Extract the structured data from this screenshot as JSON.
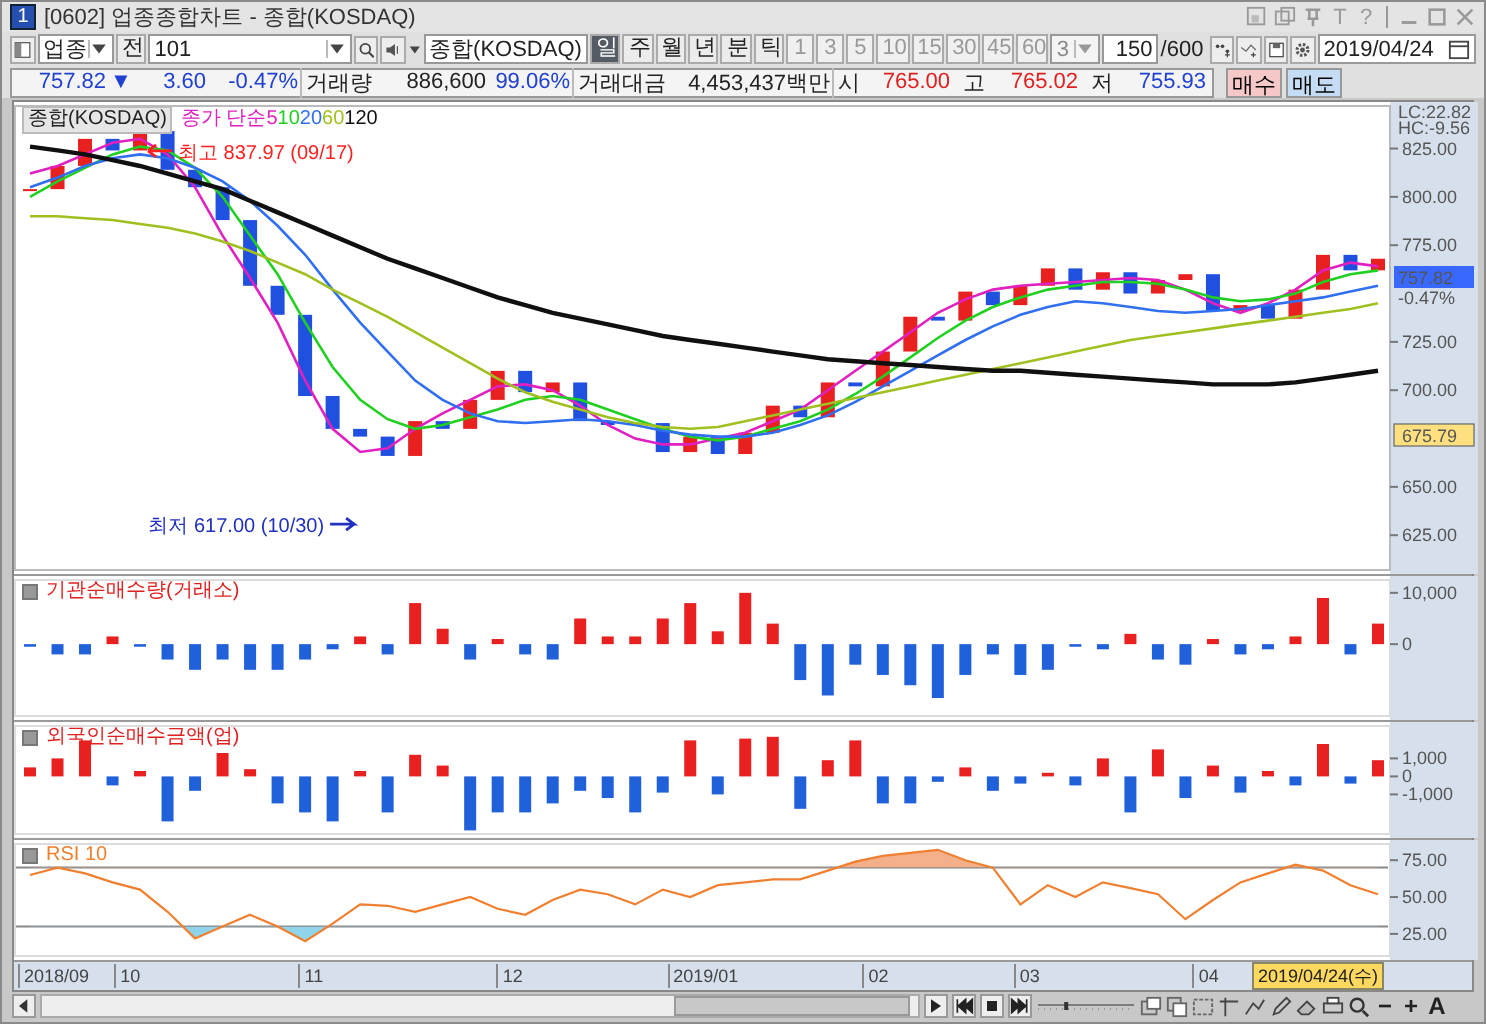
{
  "window": {
    "badge": "1",
    "title": "[0602] 업종종합차트 - 종합(KOSDAQ)",
    "help_glyphs": [
      "T",
      "?"
    ]
  },
  "toolbar": {
    "market": "업종",
    "all_button": "전",
    "code": "101",
    "name": "종합(KOSDAQ)",
    "periods": [
      {
        "label": "일",
        "selected": true
      },
      {
        "label": "주",
        "selected": false
      },
      {
        "label": "월",
        "selected": false
      },
      {
        "label": "년",
        "selected": false
      },
      {
        "label": "분",
        "selected": false
      },
      {
        "label": "틱",
        "selected": false
      }
    ],
    "intervals": [
      {
        "label": "1",
        "disabled": true
      },
      {
        "label": "3",
        "disabled": true
      },
      {
        "label": "5",
        "disabled": true
      },
      {
        "label": "10",
        "disabled": true
      },
      {
        "label": "15",
        "disabled": true
      },
      {
        "label": "30",
        "disabled": true
      },
      {
        "label": "45",
        "disabled": true
      },
      {
        "label": "60",
        "disabled": true
      }
    ],
    "interval_value": "3",
    "count": "150",
    "count_max": "/600",
    "date": "2019/04/24"
  },
  "quote": {
    "price": "757.82",
    "direction": "▼",
    "change": "3.60",
    "change_pct": "-0.47%",
    "volume_label": "거래량",
    "volume": "886,600",
    "volume_ratio": "99.06%",
    "amount_label": "거래대금",
    "amount": "4,453,437백만",
    "open_label": "시",
    "open": "765.00",
    "high_label": "고",
    "high": "765.02",
    "low_label": "저",
    "low": "755.93",
    "buy_button": "매수",
    "sell_button": "매도"
  },
  "price_chart": {
    "title": "종합(KOSDAQ)",
    "legend_prefix": "종가 단순",
    "lc": "LC:22.82",
    "hc": "HC:-9.56",
    "price_tag": "757.82",
    "price_tag_change": "-0.47%",
    "level_tag": "675.79",
    "chart_data": {
      "type": "line",
      "ylim": [
        607,
        847
      ],
      "yticks": [
        {
          "value": 825,
          "label": "825.00"
        },
        {
          "value": 800,
          "label": "800.00"
        },
        {
          "value": 775,
          "label": "775.00"
        },
        {
          "value": 725,
          "label": "725.00"
        },
        {
          "value": 700,
          "label": "700.00"
        },
        {
          "value": 650,
          "label": "650.00"
        },
        {
          "value": 625,
          "label": "625.00"
        }
      ],
      "series": [
        {
          "name": "5",
          "color": "#e020c0",
          "values": [
            812,
            816,
            822,
            828,
            830,
            822,
            805,
            780,
            758,
            735,
            705,
            680,
            668,
            670,
            680,
            688,
            695,
            702,
            703,
            700,
            692,
            682,
            675,
            672,
            672,
            675,
            678,
            684,
            690,
            700,
            710,
            720,
            730,
            740,
            747,
            752,
            754,
            755,
            756,
            757,
            758,
            757,
            752,
            745,
            740,
            745,
            752,
            762,
            766,
            764
          ]
        },
        {
          "name": "10",
          "color": "#20d020",
          "values": [
            800,
            808,
            815,
            822,
            826,
            824,
            815,
            800,
            780,
            760,
            735,
            712,
            695,
            685,
            680,
            682,
            686,
            690,
            695,
            697,
            695,
            690,
            685,
            680,
            676,
            674,
            676,
            680,
            684,
            690,
            698,
            707,
            717,
            727,
            736,
            743,
            748,
            752,
            754,
            756,
            756,
            755,
            752,
            748,
            746,
            747,
            750,
            756,
            760,
            762
          ]
        },
        {
          "name": "20",
          "color": "#3070f0",
          "values": [
            805,
            810,
            816,
            820,
            822,
            820,
            815,
            808,
            798,
            785,
            770,
            752,
            735,
            720,
            705,
            695,
            688,
            684,
            683,
            684,
            685,
            684,
            682,
            679,
            677,
            676,
            676,
            678,
            682,
            687,
            694,
            702,
            710,
            718,
            726,
            733,
            739,
            743,
            746,
            745,
            743,
            741,
            740,
            741,
            742,
            744,
            746,
            748,
            751,
            754
          ]
        },
        {
          "name": "60",
          "color": "#a0c020",
          "values": [
            790,
            790,
            789,
            788,
            786,
            784,
            781,
            777,
            772,
            766,
            760,
            752,
            745,
            738,
            730,
            722,
            714,
            706,
            699,
            694,
            690,
            686,
            683,
            681,
            680,
            681,
            684,
            687,
            690,
            693,
            696,
            699,
            702,
            705,
            708,
            711,
            714,
            717,
            720,
            723,
            726,
            728,
            730,
            732,
            734,
            736,
            738,
            740,
            742,
            745
          ]
        },
        {
          "name": "120",
          "color": "#101010",
          "values": [
            826,
            824,
            822,
            819,
            816,
            812,
            808,
            804,
            798,
            792,
            786,
            780,
            774,
            768,
            763,
            758,
            753,
            748,
            744,
            740,
            737,
            734,
            731,
            728,
            726,
            724,
            722,
            720,
            718,
            716,
            715,
            714,
            713,
            712,
            711,
            710,
            710,
            709,
            708,
            707,
            706,
            705,
            704,
            703,
            703,
            703,
            704,
            706,
            708,
            710
          ]
        }
      ],
      "annotations": [
        "최고 837.97 (09/17)",
        "최저 617.00 (10/30)"
      ]
    }
  },
  "institution_panel": {
    "title": "기관순매수량(거래소)",
    "chart_data": {
      "type": "bar",
      "ylim": [
        -14000,
        12500
      ],
      "yticks": [
        {
          "value": 10000,
          "label": "10,000"
        },
        0
      ],
      "values": [
        -500,
        -2000,
        -2000,
        1500,
        -500,
        -3000,
        -5000,
        -3000,
        -5000,
        -5000,
        -3000,
        -1000,
        1500,
        -2000,
        8000,
        3000,
        -3000,
        1000,
        -2000,
        -3000,
        5000,
        1500,
        1500,
        5000,
        8000,
        2500,
        10000,
        4000,
        -7000,
        -10000,
        -4000,
        -6000,
        -8000,
        -10500,
        -6000,
        -2000,
        -6000,
        -5000,
        -500,
        -1000,
        2000,
        -3000,
        -4000,
        1000,
        -2000,
        -1000,
        1500,
        9000,
        -2000,
        4000
      ]
    }
  },
  "foreign_panel": {
    "title": "외국인순매수금액(업)",
    "chart_data": {
      "type": "bar",
      "ylim": [
        -3200,
        2800
      ],
      "yticks": [
        {
          "value": 1000,
          "label": "1,000"
        },
        0,
        {
          "value": -1000,
          "label": "-1,000"
        }
      ],
      "values": [
        500,
        1000,
        2000,
        -500,
        300,
        -2500,
        -800,
        1300,
        400,
        -1500,
        -2000,
        -2500,
        300,
        -2000,
        1200,
        600,
        -3000,
        -2000,
        -2000,
        -1500,
        -800,
        -1200,
        -2000,
        -900,
        2000,
        -1000,
        2100,
        2200,
        -1800,
        900,
        2000,
        -1500,
        -1500,
        -300,
        500,
        -800,
        -400,
        200,
        -500,
        1000,
        -2000,
        1500,
        -1200,
        600,
        -900,
        300,
        -500,
        1800,
        -400,
        900
      ]
    }
  },
  "rsi_panel": {
    "chart_data": {
      "type": "line",
      "ylim": [
        10,
        86
      ],
      "yticks": [
        {
          "value": 75,
          "label": "75.00"
        },
        {
          "value": 50,
          "label": "50.00"
        },
        {
          "value": 25,
          "label": "25.00"
        }
      ],
      "series": [
        {
          "name": "RSI 10",
          "color": "#f08030",
          "values": [
            65,
            70,
            66,
            60,
            55,
            40,
            22,
            30,
            38,
            30,
            20,
            32,
            45,
            44,
            40,
            45,
            50,
            42,
            38,
            48,
            55,
            52,
            45,
            55,
            50,
            58,
            60,
            62,
            62,
            68,
            74,
            78,
            80,
            82,
            75,
            70,
            45,
            58,
            50,
            60,
            56,
            52,
            35,
            48,
            60,
            66,
            72,
            68,
            58,
            52
          ]
        }
      ]
    }
  },
  "x_axis": {
    "labels": [
      "2018/09",
      "10",
      "11",
      "12",
      "2019/01",
      "02",
      "03",
      "04"
    ],
    "cursor_label": "2019/04/24(수)"
  },
  "bottom_bar": {
    "zoom_slider": {
      "level": 0.3
    },
    "zoom_out": "−",
    "zoom_in": "+",
    "font": "A"
  }
}
